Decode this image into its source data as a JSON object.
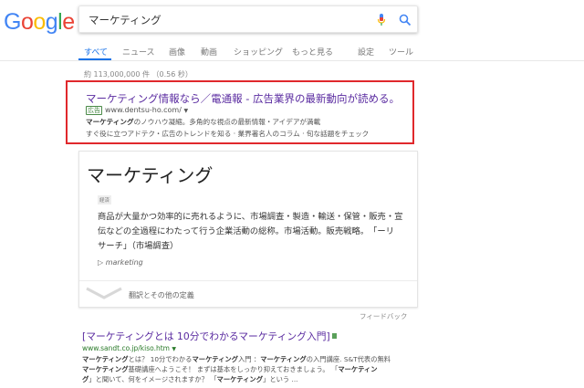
{
  "logo": {
    "letters": [
      "G",
      "o",
      "o",
      "g",
      "l",
      "e"
    ],
    "colors": [
      "#4285f4",
      "#ea4335",
      "#fbbc05",
      "#4285f4",
      "#34a853",
      "#ea4335"
    ]
  },
  "search": {
    "query": "マーケティング"
  },
  "tabs": [
    "すべて",
    "ニュース",
    "画像",
    "動画",
    "ショッピング",
    "もっと見る",
    "設定",
    "ツール"
  ],
  "stats": "約 113,000,000 件 （0.56 秒）",
  "ad": {
    "title": "マーケティング情報なら／電通報 - 広告業界の最新動向が読める。",
    "badge": "広告",
    "url": "www.dentsu-ho.com/",
    "desc1_bold": "マーケティング",
    "desc1_rest": "のノウハウ凝縮。多角的な視点の最新情報・アイデアが満載",
    "desc2": "すぐ役に立つアドテク・広告のトレンドを知る · 業界著名人のコラム · 旬な話題をチェック"
  },
  "knowledge": {
    "title": "マーケティング",
    "category": "経済",
    "def_line1": "商品が大量かつ効率的に売れるように、市場調査・製造・輸送・保管・販売・宣",
    "def_line2": "伝などの全過程にわたって行う企業活動の総称。市場活動。販売戦略。　「ーリ",
    "def_line3": "サーチ」（市場調査）",
    "source": "▷ marketing",
    "translations": "翻訳とその他の定義"
  },
  "feedback": "フィードバック",
  "result2": {
    "title": "[マーケティングとは 10分でわかるマーケティング入門]",
    "url": "www.sandt.co.jp/kiso.htm",
    "s1_a": "マーケティング",
    "s1_b": "とは？ 10分でわかる",
    "s1_c": "マーケティング",
    "s1_d": "入門 ：",
    "s1_e": "マーケティング",
    "s1_f": "の入門講座. S&T代表の無料",
    "s2_a": "マーケティング",
    "s2_b": "基礎講座へようこそ！ まずは基本をしっかり抑えておきましょう。 「",
    "s2_c": "マーケティン",
    "s3_a": "グ",
    "s3_b": "」と聞いて、何をイメージされますか？ 「",
    "s3_c": "マーケティング",
    "s3_d": "」という ..."
  }
}
